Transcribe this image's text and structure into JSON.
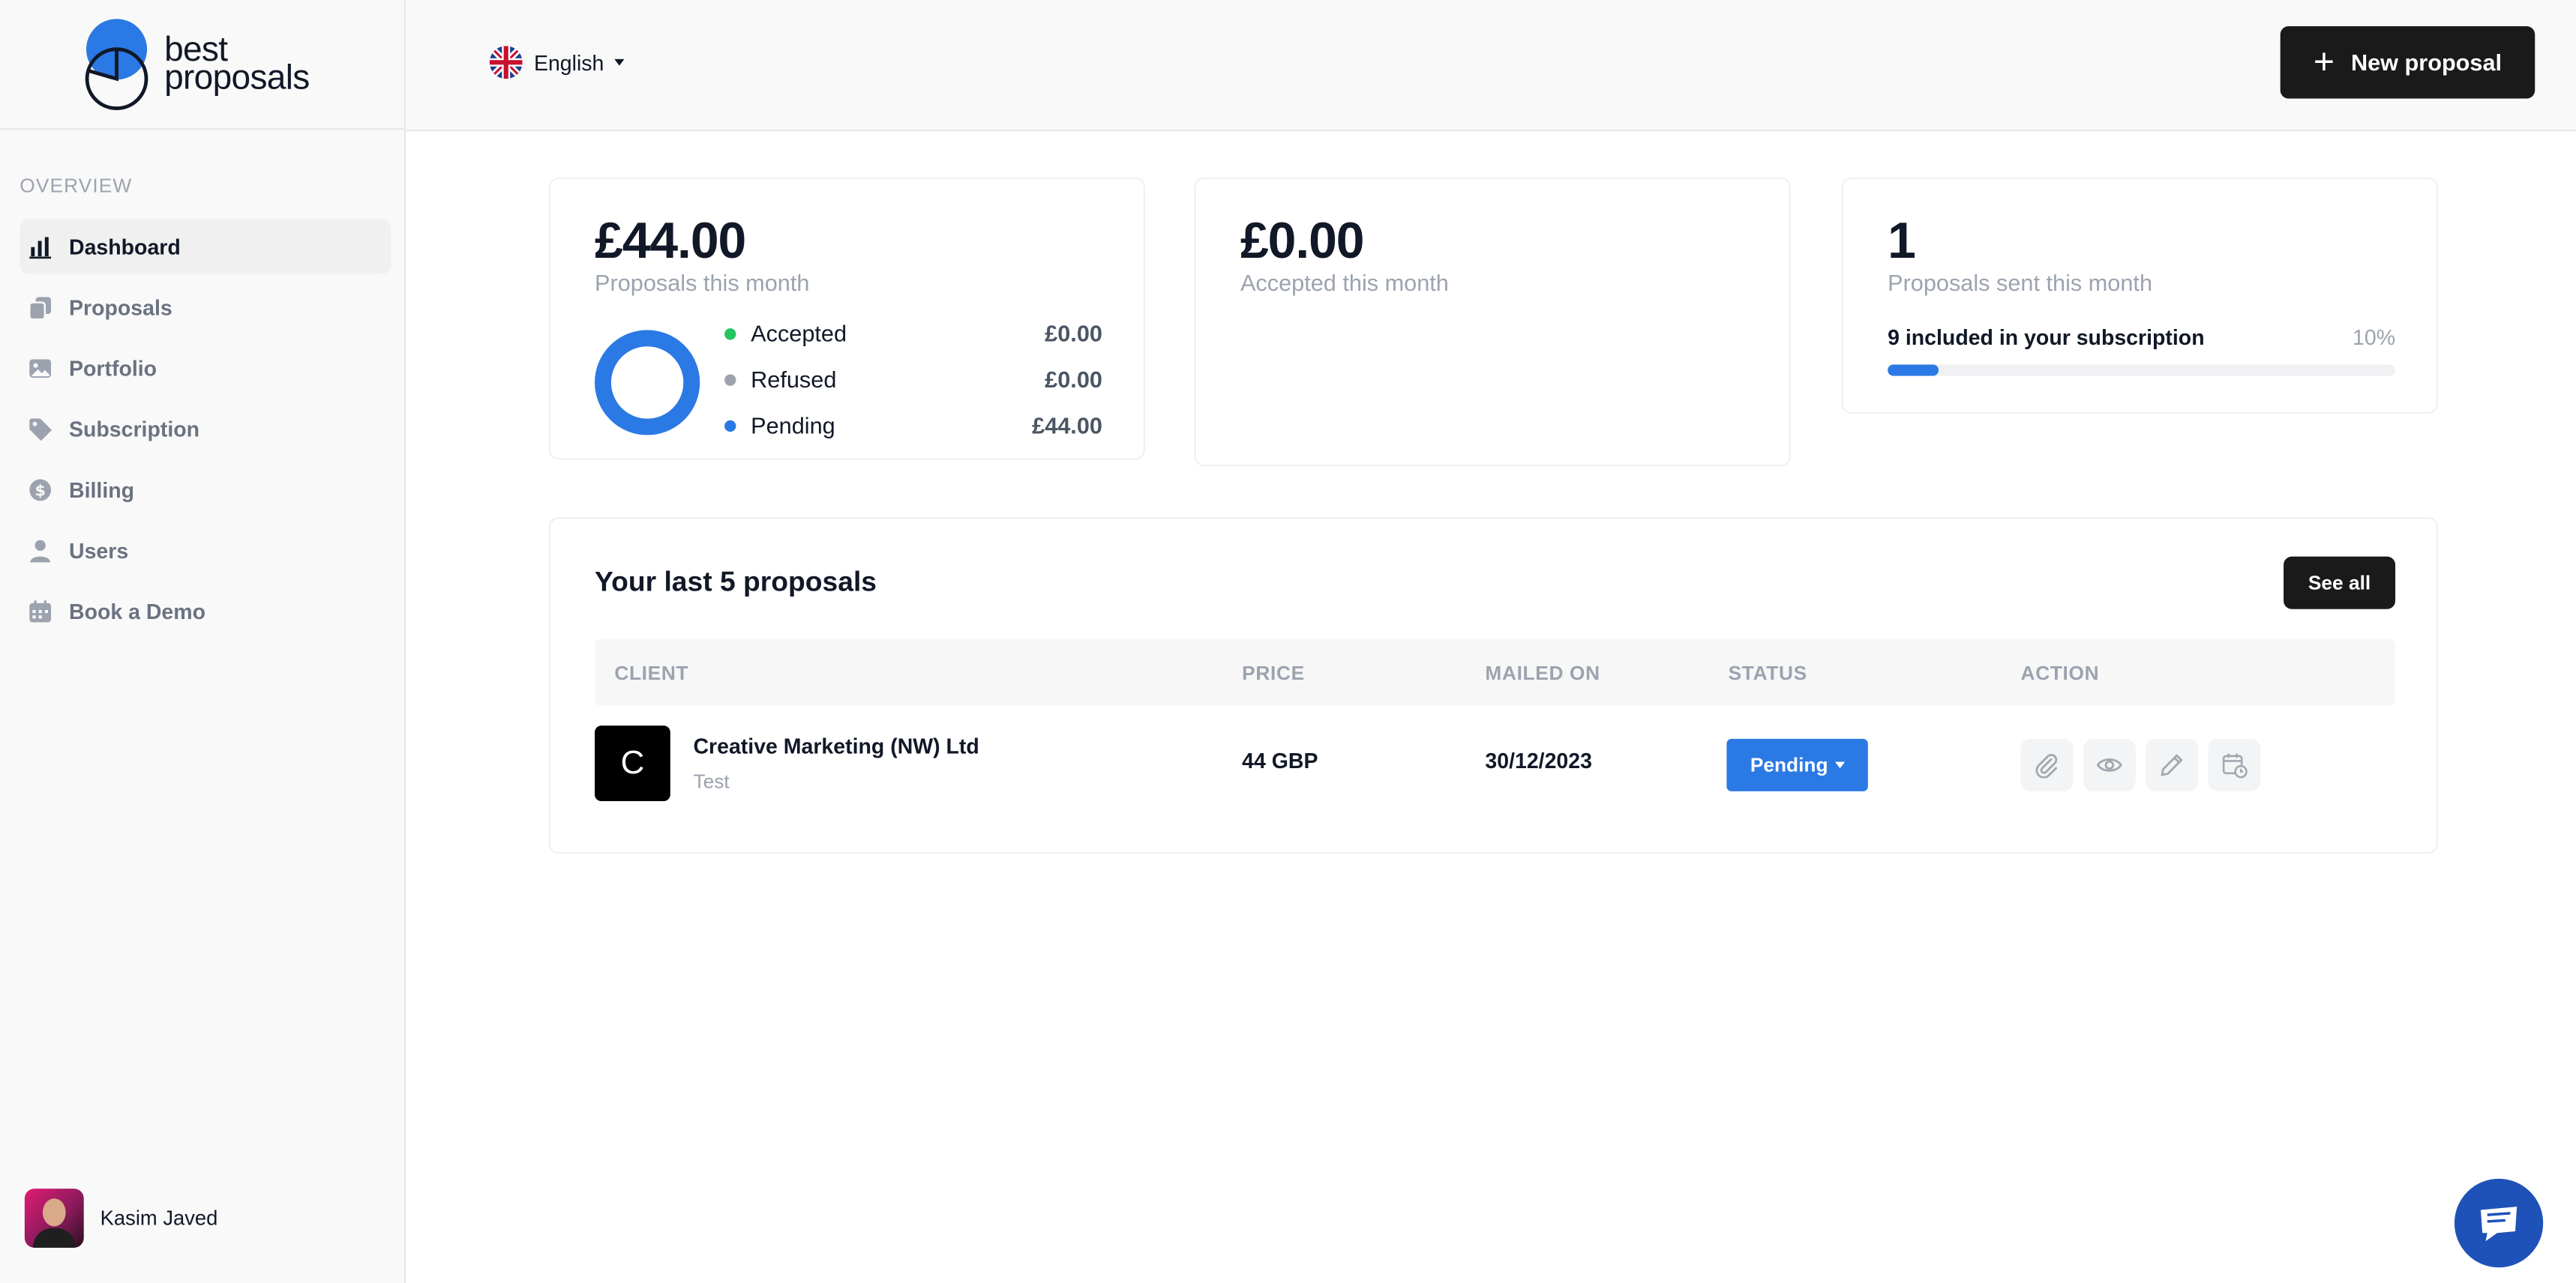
{
  "brand": {
    "name_line1": "best",
    "name_line2": "proposals",
    "color": "#2b79e4"
  },
  "sidebar": {
    "section": "OVERVIEW",
    "items": [
      {
        "label": "Dashboard",
        "icon": "bar-chart-icon",
        "active": true
      },
      {
        "label": "Proposals",
        "icon": "documents-icon"
      },
      {
        "label": "Portfolio",
        "icon": "image-icon"
      },
      {
        "label": "Subscription",
        "icon": "tag-icon"
      },
      {
        "label": "Billing",
        "icon": "dollar-icon"
      },
      {
        "label": "Users",
        "icon": "user-icon"
      },
      {
        "label": "Book a Demo",
        "icon": "calendar-icon"
      }
    ],
    "user": {
      "name": "Kasim Javed"
    }
  },
  "header": {
    "language": "English",
    "new_proposal_label": "New proposal"
  },
  "stats": {
    "proposals_month": {
      "value": "£44.00",
      "label": "Proposals this month",
      "breakdown": [
        {
          "label": "Accepted",
          "amount": "£0.00",
          "color": "#22c55e"
        },
        {
          "label": "Refused",
          "amount": "£0.00",
          "color": "#9ca3af"
        },
        {
          "label": "Pending",
          "amount": "£44.00",
          "color": "#2b79e4"
        }
      ]
    },
    "accepted_month": {
      "value": "£0.00",
      "label": "Accepted this month"
    },
    "sent_month": {
      "value": "1",
      "label": "Proposals sent this month",
      "subscription_label": "9 included in your subscription",
      "subscription_pct": "10%",
      "progress": 0.1
    }
  },
  "recent": {
    "title": "Your last 5 proposals",
    "see_all_label": "See all",
    "columns": [
      "CLIENT",
      "PRICE",
      "MAILED ON",
      "STATUS",
      "ACTION"
    ],
    "rows": [
      {
        "initial": "C",
        "client": "Creative Marketing (NW) Ltd",
        "subtitle": "Test",
        "price": "44 GBP",
        "mailed_on": "30/12/2023",
        "status": "Pending"
      }
    ],
    "actions": [
      "paperclip-icon",
      "eye-icon",
      "pencil-icon",
      "calendar-clock-icon"
    ]
  },
  "chat": {
    "icon": "chat-icon",
    "color": "#1f52b8"
  }
}
